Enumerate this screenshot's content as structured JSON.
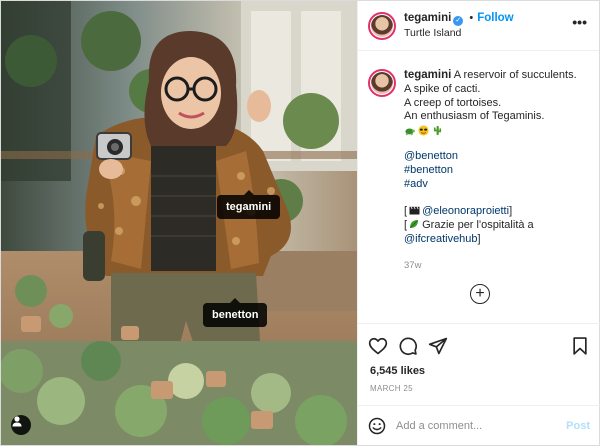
{
  "post": {
    "username": "tegamini",
    "verified_mark": "✓",
    "follow_label": "Follow",
    "dot_separator": "•",
    "location": "Turtle Island",
    "more_label": "•••"
  },
  "caption": {
    "username": "tegamini",
    "lines": [
      "A reservoir of succulents.",
      "A spike of cacti.",
      "A creep of tortoises.",
      "An enthusiasm of Tegaminis."
    ],
    "emoji_names": [
      "turtle-emoji",
      "sunglasses-emoji",
      "cactus-emoji"
    ],
    "tags": [
      "@benetton",
      "#benetton",
      "#adv"
    ],
    "credit_1_prefix": "[",
    "credit_1_mention": "@eleonoraproietti",
    "credit_1_suffix": "]",
    "credit_2_prefix": "[",
    "credit_2_text": " Grazie per l'ospitalità a",
    "credit_2_mention": "@ifcreativehub",
    "credit_2_suffix": "]",
    "time": "37w"
  },
  "photo_tags": {
    "tag_1": "tegamini",
    "tag_2": "benetton"
  },
  "load_more_label": "+",
  "likes": "6,545 likes",
  "date": "MARCH 25",
  "comment": {
    "placeholder": "Add a comment...",
    "post_label": "Post"
  },
  "colors": {
    "link": "#00376b",
    "follow": "#0095f6",
    "post_disabled": "#b2dffc",
    "muted": "#8e8e8e"
  }
}
